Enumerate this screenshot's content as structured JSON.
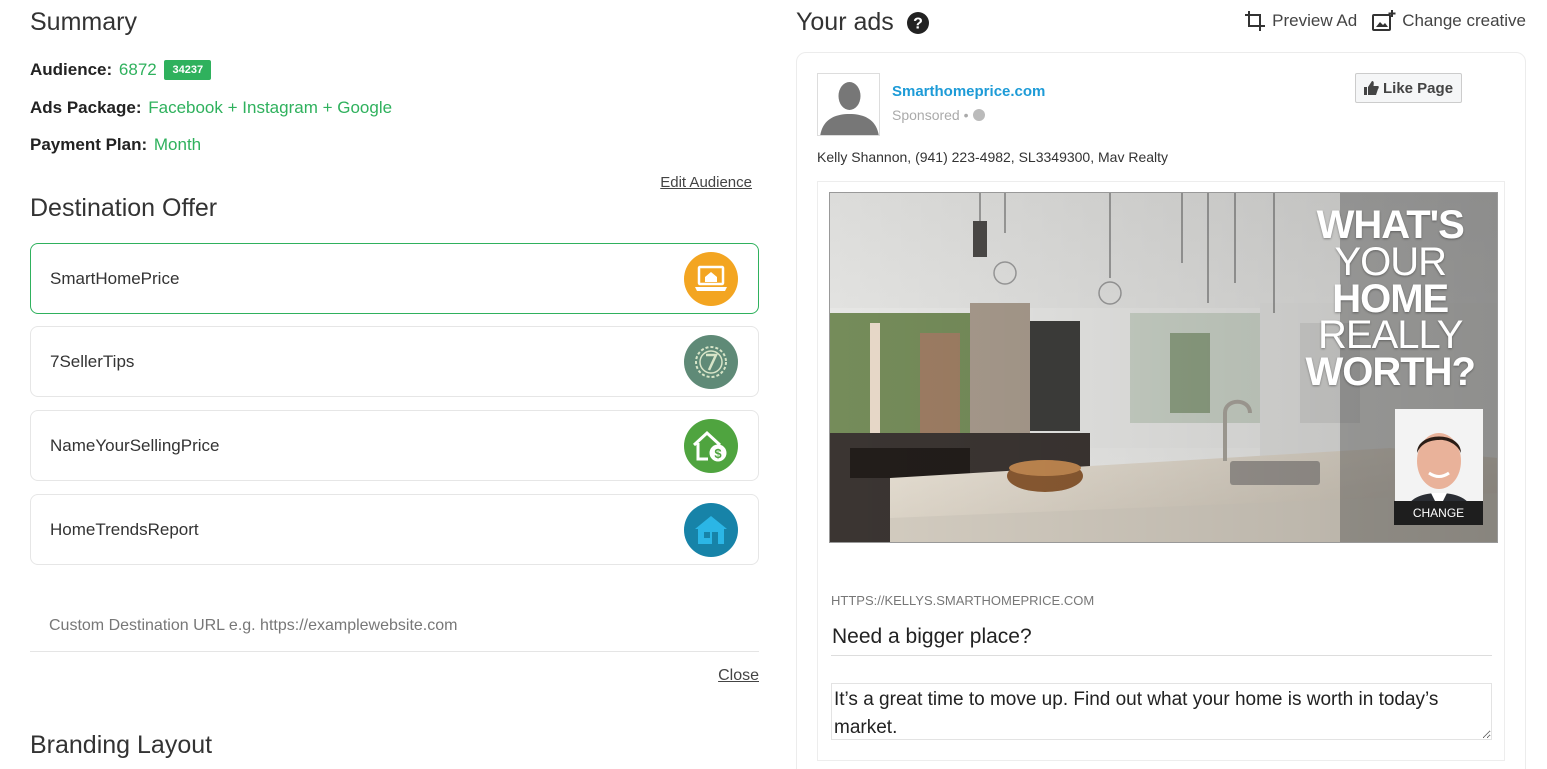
{
  "summary": {
    "title": "Summary",
    "audience_label": "Audience:",
    "audience_value": "6872",
    "audience_badge": "34237",
    "package_label": "Ads Package:",
    "package_value": "Facebook + Instagram + Google",
    "plan_label": "Payment Plan:",
    "plan_value": "Month",
    "edit_audience": "Edit Audience"
  },
  "destination": {
    "title": "Destination Offer",
    "offers": [
      {
        "label": "SmartHomePrice",
        "icon": "laptop-home-icon",
        "color": "#f3a521",
        "selected": true
      },
      {
        "label": "7SellerTips",
        "icon": "seven-badge-icon",
        "color": "#5f8a77",
        "selected": false
      },
      {
        "label": "NameYourSellingPrice",
        "icon": "house-dollar-icon",
        "color": "#4fa43f",
        "selected": false
      },
      {
        "label": "HomeTrendsReport",
        "icon": "house-icon",
        "color": "#1783a8",
        "selected": false
      }
    ],
    "custom_url_placeholder": "Custom Destination URL e.g. https://examplewebsite.com",
    "close_label": "Close"
  },
  "branding": {
    "title": "Branding Layout"
  },
  "ads": {
    "title": "Your ads",
    "preview_label": "Preview Ad",
    "change_creative_label": "Change creative",
    "page_name": "Smarthomeprice.com",
    "sponsored": "Sponsored •",
    "like_label": "Like Page",
    "agent_line": "Kelly Shannon, (941) 223-4982, SL3349300, Mav Realty",
    "image_headline": [
      "WHAT'S",
      "YOUR",
      "HOME",
      "REALLY",
      "WORTH?"
    ],
    "change_label": "CHANGE",
    "ad_url": "HTTPS://KELLYS.SMARTHOMEPRICE.COM",
    "headline_value": "Need a bigger place?",
    "body_value": "It’s a great time to move up. Find out what your home is worth in today’s market."
  },
  "colors": {
    "accent": "#2fb15d",
    "link": "#1d9bd7"
  }
}
